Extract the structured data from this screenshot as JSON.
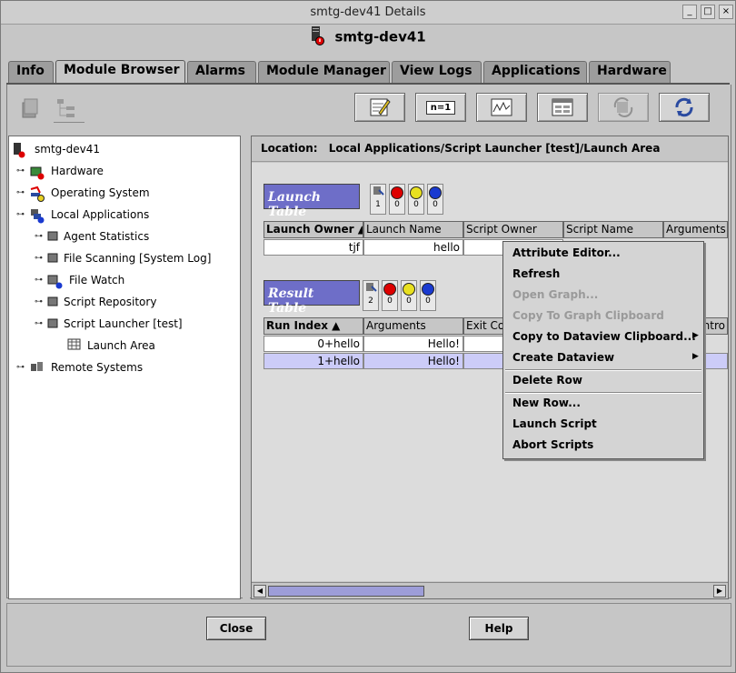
{
  "window": {
    "title": "smtg-dev41 Details"
  },
  "header": {
    "host": "smtg-dev41"
  },
  "tabs": [
    {
      "label": "Info",
      "active": false
    },
    {
      "label": "Module Browser",
      "active": true
    },
    {
      "label": "Alarms",
      "active": false
    },
    {
      "label": "Module Manager",
      "active": false
    },
    {
      "label": "View Logs",
      "active": false
    },
    {
      "label": "Applications",
      "active": false
    },
    {
      "label": "Hardware",
      "active": false
    }
  ],
  "toolbar": {
    "left_icons": [
      "server-add-icon",
      "hierarchy-icon"
    ],
    "buttons": [
      "edit-attributes-icon",
      "n-equals-1-icon",
      "graph-icon",
      "dataview-icon",
      "cycle-icon",
      "refresh-icon"
    ],
    "n_label": "n=1"
  },
  "tree": {
    "root": "smtg-dev41",
    "items": [
      {
        "label": "Hardware",
        "icon": "hardware-icon"
      },
      {
        "label": "Operating System",
        "icon": "os-icon"
      },
      {
        "label": "Local Applications",
        "icon": "local-apps-icon"
      },
      {
        "label": "Agent Statistics",
        "icon": "module-icon"
      },
      {
        "label": "File Scanning [System Log]",
        "icon": "module-icon"
      },
      {
        "label": "File Watch",
        "icon": "module-icon"
      },
      {
        "label": "Script Repository",
        "icon": "module-icon"
      },
      {
        "label": "Script Launcher [test]",
        "icon": "module-icon"
      },
      {
        "label": "Launch Area",
        "icon": "table-icon"
      },
      {
        "label": "Remote Systems",
        "icon": "remote-icon"
      }
    ]
  },
  "location": {
    "label": "Location:",
    "path": "Local Applications/Script Launcher [test]/Launch Area"
  },
  "launch_table": {
    "title": "Launch Table",
    "indicators": [
      "1",
      "0",
      "0",
      "0"
    ],
    "columns": [
      "Launch Owner",
      "Launch Name",
      "Script Owner",
      "Script Name",
      "Arguments"
    ],
    "rows": [
      [
        "tjf",
        "hello",
        "",
        "",
        ""
      ]
    ]
  },
  "result_table": {
    "title": "Result Table",
    "indicators": [
      "2",
      "0",
      "0",
      "0"
    ],
    "columns": [
      "Run Index",
      "Arguments",
      "Exit Co",
      "ntro"
    ],
    "rows": [
      [
        "0+hello",
        "Hello!"
      ],
      [
        "1+hello",
        "Hello!"
      ]
    ]
  },
  "context_menu": {
    "items": [
      {
        "label": "Attribute Editor...",
        "enabled": true
      },
      {
        "label": "Refresh",
        "enabled": true
      },
      {
        "label": "Open Graph...",
        "enabled": false
      },
      {
        "label": "Copy To Graph Clipboard",
        "enabled": false
      },
      {
        "label": "Copy to Dataview Clipboard...",
        "enabled": true,
        "submenu": true
      },
      {
        "label": "Create Dataview",
        "enabled": true,
        "submenu": true
      },
      {
        "label": "Delete Row",
        "enabled": true
      },
      {
        "label": "New Row...",
        "enabled": true
      },
      {
        "label": "Launch Script",
        "enabled": true
      },
      {
        "label": "Abort Scripts",
        "enabled": true
      }
    ]
  },
  "buttons": {
    "close": "Close",
    "help": "Help"
  },
  "colors": {
    "table_header": "#6e6ec8",
    "selected_row": "#ccccf8",
    "background": "#c6c6c6"
  }
}
